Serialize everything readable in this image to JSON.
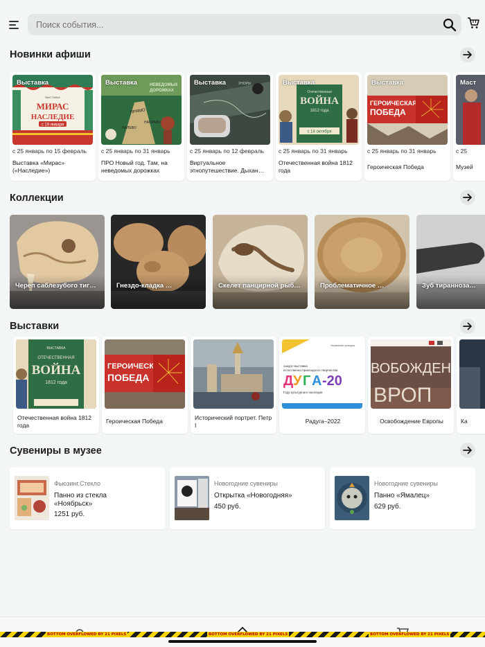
{
  "search": {
    "placeholder": "Поиск события..."
  },
  "sections": {
    "afisha": "Новинки афиши",
    "collections": "Коллекции",
    "exhibitions": "Выставки",
    "souvenirs": "Сувениры в музее"
  },
  "afisha": [
    {
      "badge": "Выставка",
      "date": "с 25 январь по 15 февраль",
      "title": "Выставка «Мирас» («Наследие»)",
      "poster": "МИРАС НАСЛЕДИЕ",
      "poster_sub": "с 19 января"
    },
    {
      "badge": "Выставка",
      "date": "с 25 январь по 31 январь",
      "title": "ПРО Новый год. Там, на неведомых дорожках",
      "poster": "НЕВЕДОМЫХ ДОРОЖКАХ"
    },
    {
      "badge": "Выставка",
      "date": "с 25 январь по 12 февраль",
      "title": "Виртуальное этнопутешествие. Дыхан…"
    },
    {
      "badge": "Выставка",
      "date": "с 25 январь по 31 январь",
      "title": "Отечественная война 1812 года",
      "poster": "Отечественная ВОЙНА",
      "poster_sub": "1812 года"
    },
    {
      "badge": "Выставка",
      "date": "с 25 январь по 31 январь",
      "title": "Героическая Победа",
      "poster": "ГЕРОИЧЕСКАЯ ПОБЕДА"
    },
    {
      "badge": "Маст",
      "date": "с 25",
      "title": "Музей"
    }
  ],
  "collections": [
    {
      "label": "Череп саблезубого тиг…"
    },
    {
      "label": "Гнездо-кладка …"
    },
    {
      "label": "Скелет панцирной рыб…"
    },
    {
      "label": "Проблематичное …"
    },
    {
      "label": "Зуб тиранноза…"
    }
  ],
  "exhibitions": [
    {
      "title": "Отечественная война 1812 года",
      "poster": "ОТЕЧЕСТВЕННАЯ ВОЙНА",
      "poster_sub": "1812 года"
    },
    {
      "title": "Героическая Победа",
      "poster": "ГЕРОИЧЕСКАЯ ПОБЕДА"
    },
    {
      "title": "Исторический портрет. Петр I"
    },
    {
      "title": "Радуга–2022",
      "poster": "ДУГА-20",
      "poster_sub": "Году культурного наследия"
    },
    {
      "title": "Освобождение Европы",
      "poster": "ВОБОЖДЕН ВРОП"
    },
    {
      "title": "Ка"
    }
  ],
  "souvenirs": [
    {
      "category": "Фьюзинг.Стекло",
      "name": "Панно из стекла «Ноябрьск»",
      "price": "1251 руб."
    },
    {
      "category": "Новогодние сувениры",
      "name": "Открытка «Новогодняя»",
      "price": "450 руб."
    },
    {
      "category": "Новогодние сувениры",
      "name": "Панно «Ямалец»",
      "price": "629 руб."
    }
  ],
  "overflow_warning": "BOTTOM OVERFLOWED BY 21 PIXELS",
  "colors": {
    "background": "#f2f6f6",
    "overflow_yellow": "#f5d400",
    "overflow_red": "#c00000"
  }
}
